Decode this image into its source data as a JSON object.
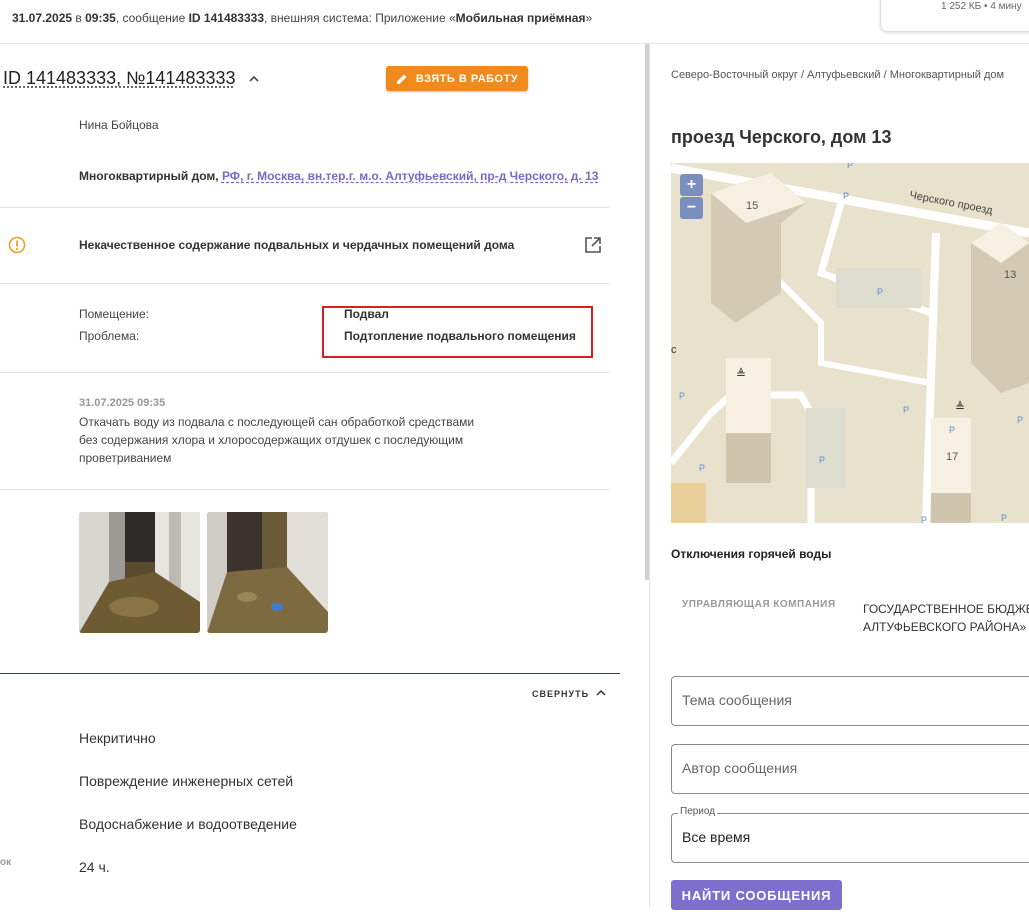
{
  "topbar": {
    "date": "31.07.2025",
    "at": " в ",
    "time": "09:35",
    "msg_word": ", сообщение ",
    "msg_id": "ID 141483333",
    "ext_system_label": ", внешняя система: Приложение «",
    "ext_system": "Мобильная приёмная",
    "ext_system_end": "»",
    "file_info": "1 252 КБ • 4 мину"
  },
  "message": {
    "title": "ID 141483333, №141483333",
    "take_button": "ВЗЯТЬ В РАБОТУ",
    "author": "Нина Бойцова",
    "building_type": "Многоквартирный дом,",
    "address_link": "РФ, г. Москва, вн.тер.г. м.о. Алтуфьевский, пр-д Черского, д. 13",
    "category": "Некачественное содержание подвальных и чердачных помещений дома",
    "room_label": "Помещение:",
    "room_value": "Подвал",
    "problem_label": "Проблема:",
    "problem_value": "Подтопление подвального помещения",
    "answer_date": "31.07.2025 09:35",
    "answer_text": "Откачать воду из подвала с последующей сан обработкой средствами без содержания хлора и хлоросодержащих отдушек с последующим проветриванием",
    "collapse_label": "СВЕРНУТЬ",
    "criticality": "Некритично",
    "damage": "Повреждение инженерных сетей",
    "system": "Водоснабжение и водоотведение",
    "deadline_label_fragment": "ок",
    "deadline": "24 ч."
  },
  "location": {
    "breadcrumb": "Северо-Восточный округ / Алтуфьевский / Многоквартирный дом",
    "address": "проезд Черского, дом 13",
    "map": {
      "street_label": "Черского проезд",
      "buildings": [
        "15",
        "13",
        "17"
      ],
      "zoom_in": "+",
      "zoom_out": "−"
    },
    "hot_water_title": "Отключения горячей воды",
    "uk_label": "УПРАВЛЯЮЩАЯ КОМПАНИЯ",
    "uk_value_line1": "ГОСУДАРСТВЕННОЕ БЮДЖЕ",
    "uk_value_line2": "АЛТУФЬЕВСКОГО РАЙОНА»"
  },
  "search": {
    "topic_placeholder": "Тема сообщения",
    "author_placeholder": "Автор сообщения",
    "period_label": "Период",
    "period_value": "Все время",
    "find_button": "НАЙТИ СООБЩЕНИЯ"
  },
  "colors": {
    "accent_orange": "#f08a1c",
    "accent_purple": "#7e6fcf",
    "highlight_red": "#d91f1f",
    "warning": "#f0a020"
  }
}
